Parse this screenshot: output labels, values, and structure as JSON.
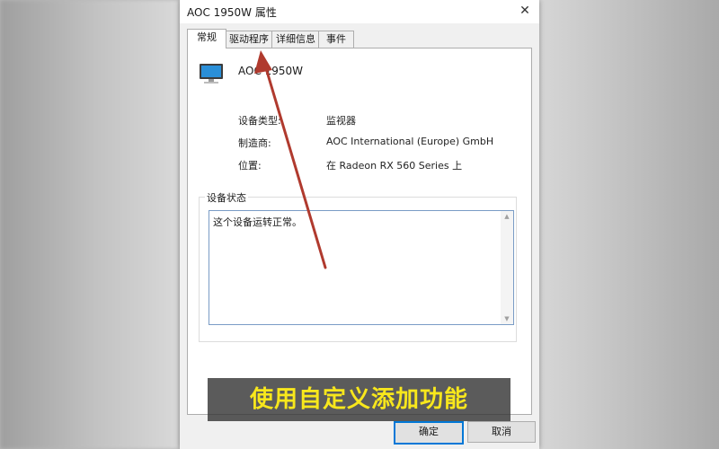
{
  "window": {
    "title": "AOC 1950W 属性",
    "close_glyph": "✕"
  },
  "tabs": [
    {
      "label": "常规",
      "active": true
    },
    {
      "label": "驱动程序",
      "active": false
    },
    {
      "label": "详细信息",
      "active": false
    },
    {
      "label": "事件",
      "active": false
    }
  ],
  "general": {
    "device_name": "AOC 1950W",
    "device_icon": "monitor-icon",
    "properties": [
      {
        "label": "设备类型:",
        "value": "监视器"
      },
      {
        "label": "制造商:",
        "value": "AOC International (Europe) GmbH"
      },
      {
        "label": "位置:",
        "value": "在 Radeon RX 560 Series 上"
      }
    ],
    "status_group_label": "设备状态",
    "status_text": "这个设备运转正常。"
  },
  "buttons": {
    "ok_label": "确定",
    "cancel_label": "取消"
  },
  "overlay": {
    "caption": "使用自定义添加功能",
    "arrow_color": "#b03a2e",
    "caption_color": "#f8e71c"
  },
  "colors": {
    "accent": "#0078d7",
    "monitor_screen": "#2a8fd8"
  }
}
